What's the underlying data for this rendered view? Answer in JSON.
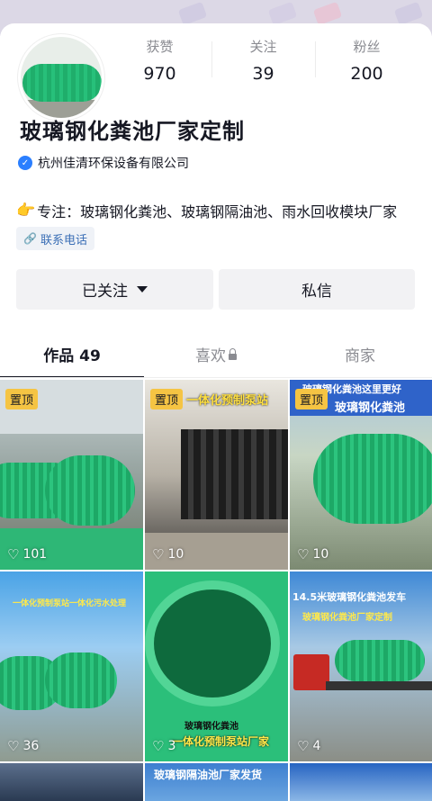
{
  "profile": {
    "name": "玻璃钢化粪池厂家定制",
    "verified_company": "杭州佳清环保设备有限公司",
    "bio": "专注：玻璃钢化粪池、玻璃钢隔油池、雨水回收模块厂家",
    "contact_label": "联系电话"
  },
  "stats": [
    {
      "label": "获赞",
      "value": "970"
    },
    {
      "label": "关注",
      "value": "39"
    },
    {
      "label": "粉丝",
      "value": "200"
    }
  ],
  "actions": {
    "follow_label": "已关注",
    "message_label": "私信"
  },
  "tabs": [
    {
      "label": "作品 49"
    },
    {
      "label": "喜欢"
    },
    {
      "label": "商家"
    }
  ],
  "videos": [
    {
      "pinned": "置顶",
      "likes": "101",
      "caption": ""
    },
    {
      "pinned": "置顶",
      "likes": "10",
      "caption": "一体化预制泵站"
    },
    {
      "pinned": "置顶",
      "likes": "10",
      "caption": "玻璃钢化粪池"
    },
    {
      "pinned": "",
      "likes": "36",
      "caption": "一体化预制泵站一体化污水处理"
    },
    {
      "pinned": "",
      "likes": "3",
      "caption": "一体化预制泵站厂家"
    },
    {
      "pinned": "",
      "likes": "4",
      "caption": "14.5米玻璃钢化粪池发车"
    },
    {
      "pinned": "",
      "likes": "",
      "caption": ""
    },
    {
      "pinned": "",
      "likes": "",
      "caption": "玻璃钢隔油池厂家发货"
    },
    {
      "pinned": "",
      "likes": "",
      "caption": ""
    }
  ],
  "video_subtitles": {
    "v2_top": "玻璃钢化粪池这里更好",
    "v6_sub": "玻璃钢化粪池厂家定制",
    "v5_bottom": "玻璃钢化粪池"
  }
}
